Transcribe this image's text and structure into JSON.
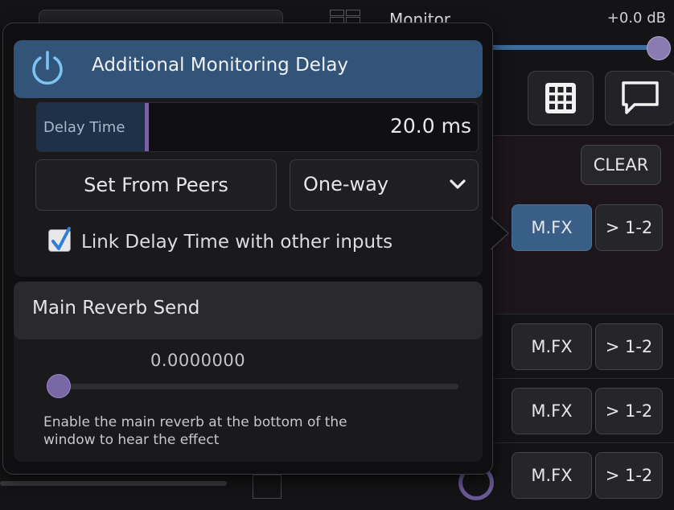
{
  "background": {
    "monitor": {
      "label": "Monitor",
      "level": "+0.0 dB",
      "slider_fraction": 1.0
    },
    "icons": [
      "grid-icon",
      "chat-bubble-icon"
    ],
    "clear_label": "CLEAR",
    "fx_rows": [
      {
        "fx_label": "M.FX",
        "route_label": "> 1-2",
        "active": true
      },
      {
        "fx_label": "M.FX",
        "route_label": "> 1-2",
        "active": false
      },
      {
        "fx_label": "M.FX",
        "route_label": "> 1-2",
        "active": false
      },
      {
        "fx_label": "M.FX",
        "route_label": "> 1-2",
        "active": false
      }
    ]
  },
  "popup": {
    "monitoring_delay": {
      "title": "Additional Monitoring Delay",
      "enabled": true,
      "power_icon": "power-icon",
      "delay_label": "Delay Time",
      "delay_value": "20.0 ms",
      "delay_fill_fraction": 0.25,
      "set_from_peers_label": "Set From Peers",
      "mode": {
        "selected": "One-way",
        "icon": "chevron-down-icon"
      },
      "link_checkbox": {
        "checked": true,
        "label": "Link Delay Time with other inputs"
      }
    },
    "reverb_send": {
      "title": "Main Reverb Send",
      "value": "0.0000000",
      "slider_fraction": 0.0,
      "hint": "Enable the main reverb at the bottom of the window to hear the effect"
    }
  },
  "colors": {
    "accent_blue": "#325478",
    "knob_purple": "#7a68a6",
    "popup_bg": "#0f0f11"
  }
}
